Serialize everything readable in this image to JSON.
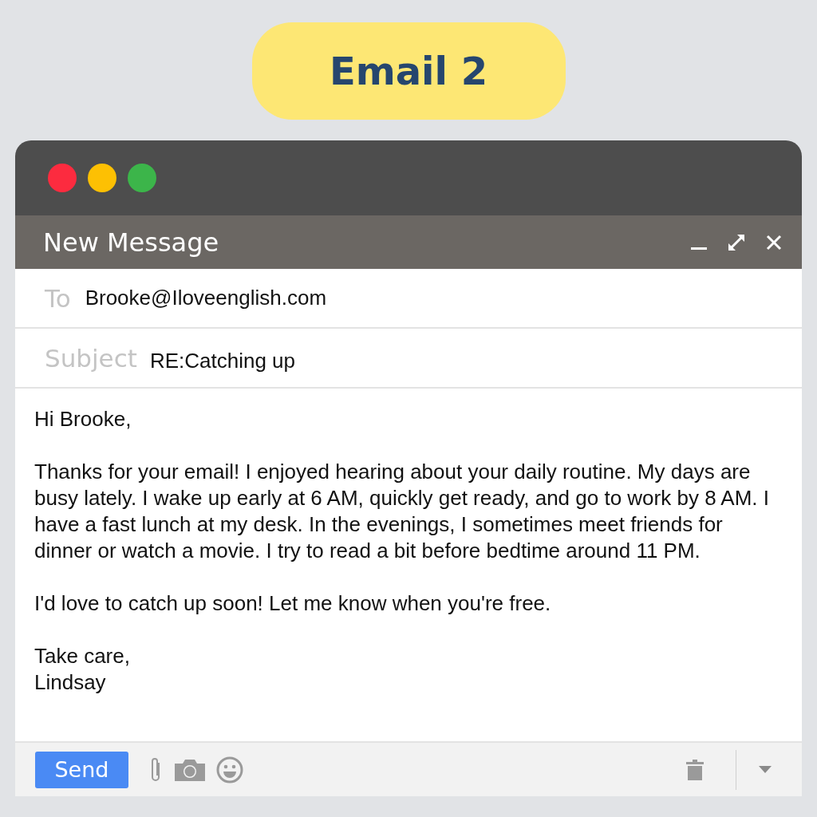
{
  "badge": "Email 2",
  "window": {
    "title": "New Message"
  },
  "fields": [
    {
      "label": "To",
      "value": "Brooke@Iloveenglish.com"
    },
    {
      "label": "Subject",
      "value": "RE:Catching up"
    }
  ],
  "body": [
    "Hi Brooke,",
    "Thanks for your email! I enjoyed hearing about your daily routine. My days are busy lately. I wake up early at 6 AM, quickly get ready, and go to work by 8 AM. I have a fast lunch at my desk. In the evenings, I sometimes meet friends for dinner or watch a movie. I try to read a bit before bedtime around 11 PM.",
    "I'd love to catch up soon! Let me know when you're free.",
    "Take care,\nLindsay"
  ],
  "send_button": "Send"
}
